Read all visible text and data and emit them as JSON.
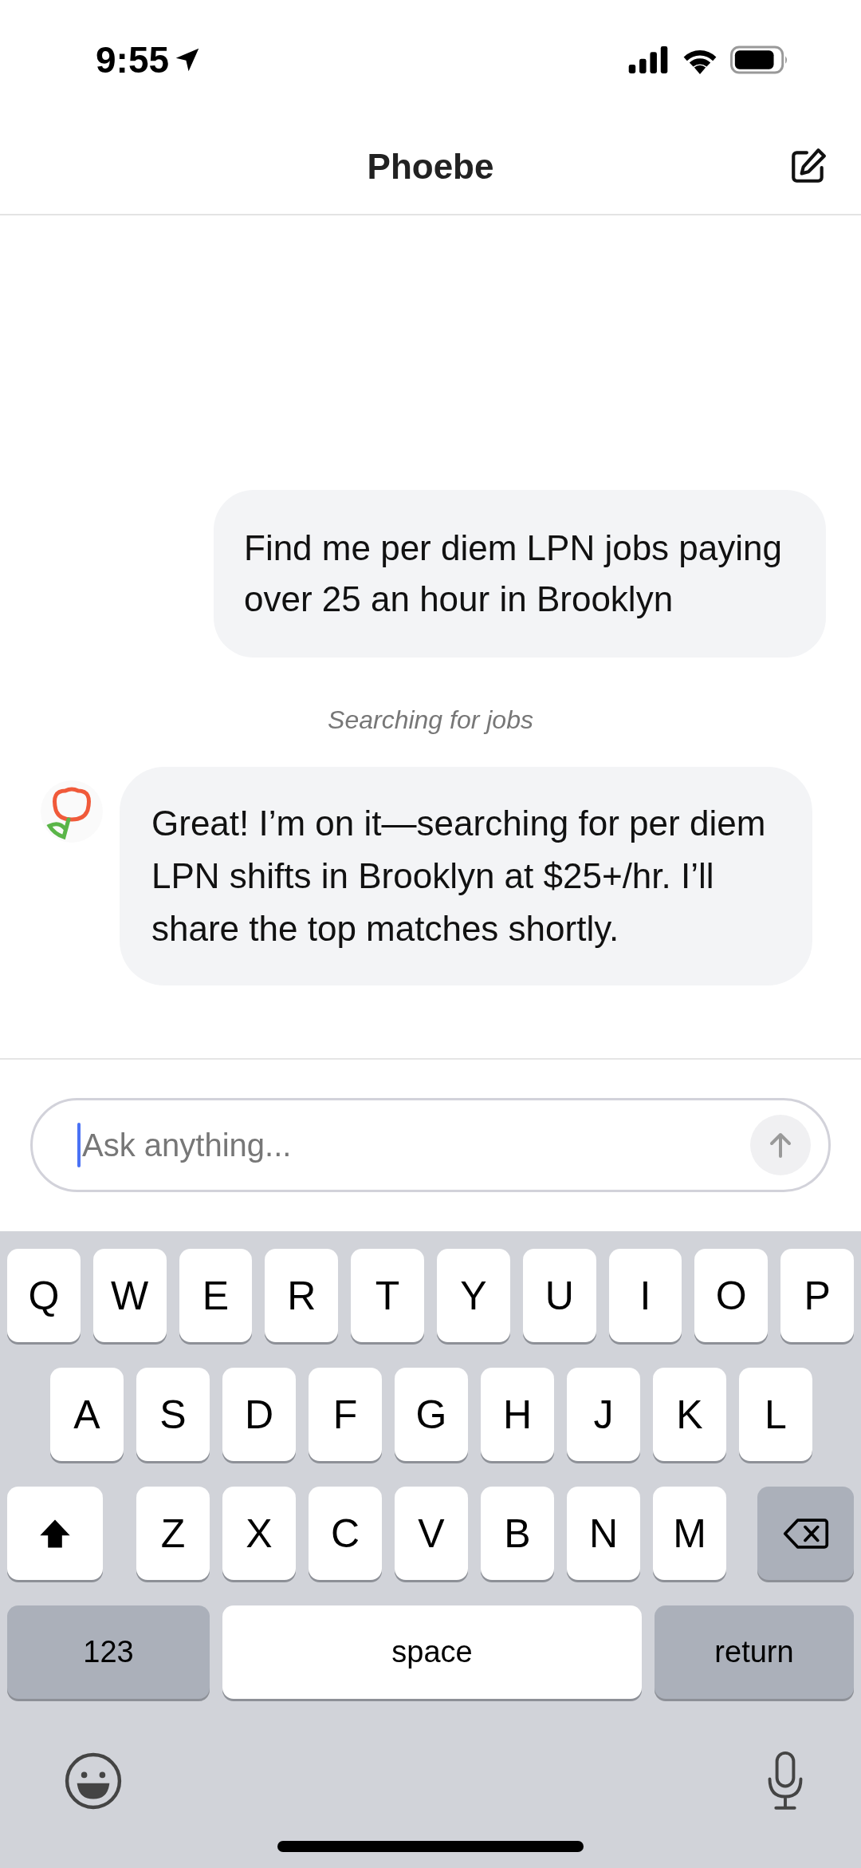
{
  "status_bar": {
    "time": "9:55"
  },
  "header": {
    "title": "Phoebe"
  },
  "messages": [
    {
      "kind": "user",
      "text": "Find me per diem LPN jobs paying over 25 an hour in Brooklyn"
    },
    {
      "kind": "status",
      "text": "Searching for jobs"
    },
    {
      "kind": "assistant",
      "text": "Great! I’m on it—searching for per diem LPN shifts in Brooklyn at $25+/hr. I’ll share the top matches shortly."
    }
  ],
  "composer": {
    "placeholder": "Ask anything..."
  },
  "keyboard": {
    "rows": [
      {
        "keys": [
          {
            "kind": "letter",
            "label": "Q"
          },
          {
            "kind": "letter",
            "label": "W"
          },
          {
            "kind": "letter",
            "label": "E"
          },
          {
            "kind": "letter",
            "label": "R"
          },
          {
            "kind": "letter",
            "label": "T"
          },
          {
            "kind": "letter",
            "label": "Y"
          },
          {
            "kind": "letter",
            "label": "U"
          },
          {
            "kind": "letter",
            "label": "I"
          },
          {
            "kind": "letter",
            "label": "O"
          },
          {
            "kind": "letter",
            "label": "P"
          }
        ]
      },
      {
        "keys": [
          {
            "kind": "letter",
            "label": "A"
          },
          {
            "kind": "letter",
            "label": "S"
          },
          {
            "kind": "letter",
            "label": "D"
          },
          {
            "kind": "letter",
            "label": "F"
          },
          {
            "kind": "letter",
            "label": "G"
          },
          {
            "kind": "letter",
            "label": "H"
          },
          {
            "kind": "letter",
            "label": "J"
          },
          {
            "kind": "letter",
            "label": "K"
          },
          {
            "kind": "letter",
            "label": "L"
          }
        ]
      },
      {
        "keys": [
          {
            "kind": "shift"
          },
          {
            "kind": "letter",
            "label": "Z"
          },
          {
            "kind": "letter",
            "label": "X"
          },
          {
            "kind": "letter",
            "label": "C"
          },
          {
            "kind": "letter",
            "label": "V"
          },
          {
            "kind": "letter",
            "label": "B"
          },
          {
            "kind": "letter",
            "label": "N"
          },
          {
            "kind": "letter",
            "label": "M"
          },
          {
            "kind": "backspace"
          }
        ]
      },
      {
        "keys": [
          {
            "kind": "mode",
            "label": "123"
          },
          {
            "kind": "space",
            "label": "space"
          },
          {
            "kind": "return",
            "label": "return"
          }
        ]
      }
    ]
  }
}
